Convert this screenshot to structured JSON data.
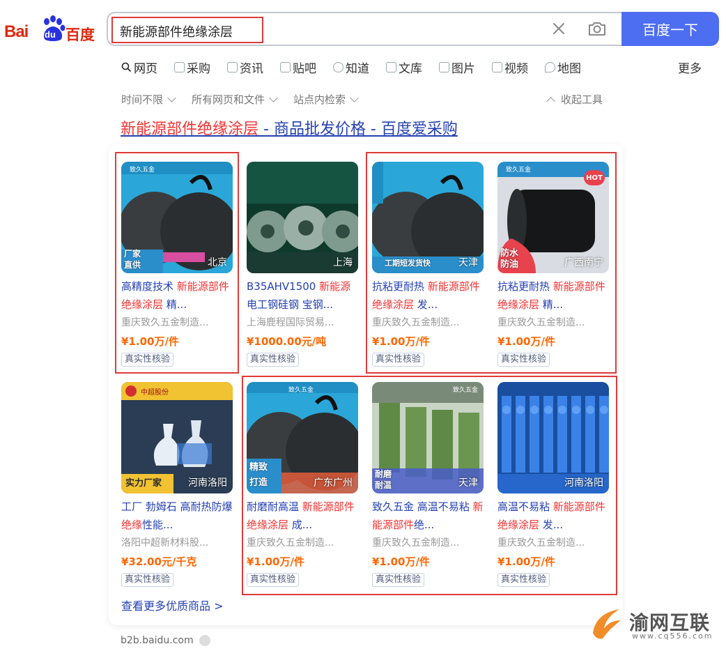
{
  "logo": {
    "bai": "Bai",
    "du": "du",
    "baidu_cn": "百度"
  },
  "search": {
    "query": "新能源部件绝缘涂层",
    "button_label": "百度一下"
  },
  "tabs": [
    {
      "label": "网页",
      "icon": "search-icon"
    },
    {
      "label": "采购",
      "icon": "bag-icon"
    },
    {
      "label": "资讯",
      "icon": "news-icon"
    },
    {
      "label": "贴吧",
      "icon": "tieba-icon"
    },
    {
      "label": "知道",
      "icon": "question-icon"
    },
    {
      "label": "文库",
      "icon": "doc-icon"
    },
    {
      "label": "图片",
      "icon": "image-icon"
    },
    {
      "label": "视频",
      "icon": "video-icon"
    },
    {
      "label": "地图",
      "icon": "map-icon"
    }
  ],
  "more_tab": "更多",
  "filters": [
    "时间不限",
    "所有网页和文件",
    "站点内检索"
  ],
  "collapse_tools": "收起工具",
  "result": {
    "title_highlight": "新能源部件绝缘涂层",
    "title_rest": " - 商品批发价格 - 百度爱采购"
  },
  "products": [
    {
      "title_plain": "高精度技术 ",
      "title_hl": "新能源部件绝缘涂层",
      "title_tail": " 精...",
      "shop": "重庆致久五金制造...",
      "price": "¥1.00万/件",
      "badge": "真实性核验",
      "location": "北京",
      "tag": "厂家\n直供",
      "brand": "致久五金"
    },
    {
      "title_plain": "B35AHV1500 ",
      "title_hl": "新能源",
      "title_tail": "电工钢硅钢 宝钢...",
      "shop": "上海鹿程国际贸易...",
      "price": "¥1000.00元/吨",
      "badge": "真实性核验",
      "location": "上海",
      "tag": "",
      "brand": ""
    },
    {
      "title_plain": "抗粘更耐热 ",
      "title_hl": "新能源部件绝缘涂层",
      "title_tail": " 发...",
      "shop": "重庆致久五金制造...",
      "price": "¥1.00万/件",
      "badge": "真实性核验",
      "location": "天津",
      "tag": "工期短发货快",
      "brand": "致久五金"
    },
    {
      "title_plain": "抗粘更耐热 ",
      "title_hl": "新能源部件绝缘涂层",
      "title_tail": " 精...",
      "shop": "重庆致久五金制造...",
      "price": "¥1.00万/件",
      "badge": "真实性核验",
      "location": "广西南宁",
      "tag": "防水\n防油",
      "brand": "致久五金",
      "hot": "HOT"
    },
    {
      "title_plain": "工厂 勃姆石 高耐热防爆 ",
      "title_hl": "绝缘",
      "title_tail": "性能...",
      "shop": "洛阳中超新材料股...",
      "price": "¥32.00元/千克",
      "badge": "真实性核验",
      "location": "河南洛阳",
      "tag": "实力厂家",
      "brand": "中超股份"
    },
    {
      "title_plain": "耐磨耐高温 ",
      "title_hl": "新能源部件绝缘涂层",
      "title_tail": " 成...",
      "shop": "重庆致久五金制造...",
      "price": "¥1.00万/件",
      "badge": "真实性核验",
      "location": "广东广州",
      "tag": "精致\n打造",
      "brand": "致久五金"
    },
    {
      "title_plain": "致久五金 高温不易粘 ",
      "title_hl": "新能源部件",
      "title_tail": "绝...",
      "shop": "重庆致久五金制造...",
      "price": "¥1.00万/件",
      "badge": "真实性核验",
      "location": "天津",
      "tag": "耐磨\n耐温",
      "brand": "致久五金"
    },
    {
      "title_plain": "高温不易粘 ",
      "title_hl": "新能源部件绝缘涂层",
      "title_tail": " 发...",
      "shop": "重庆致久五金制造...",
      "price": "¥1.00万/件",
      "badge": "真实性核验",
      "location": "河南洛阳",
      "tag": "",
      "brand": ""
    }
  ],
  "more_goods": "查看更多优质商品 >",
  "site_url": "b2b.baidu.com",
  "watermark": {
    "name": "渝网互联",
    "url": "www.cq556.com"
  },
  "colors": {
    "accent": "#4e6ef2",
    "highlight": "#f73131",
    "link": "#2440b3",
    "price": "#ff6600",
    "annotation": "#e03a3a"
  }
}
